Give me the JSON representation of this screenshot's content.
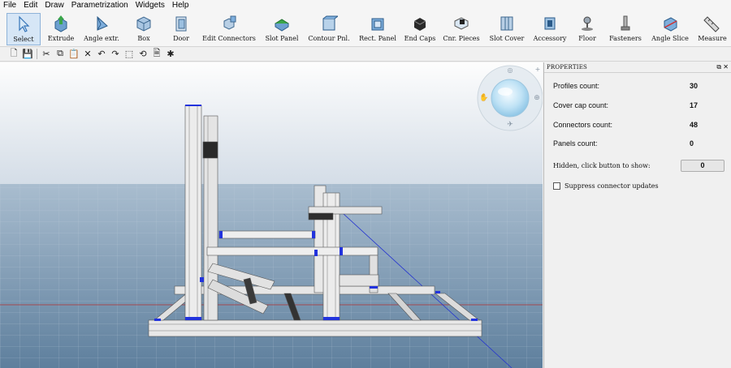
{
  "menu": [
    "File",
    "Edit",
    "Draw",
    "Parametrization",
    "Widgets",
    "Help"
  ],
  "ribbon": [
    {
      "label": "Select",
      "icon": "cursor-arrow-icon",
      "active": true
    },
    {
      "label": "Extrude",
      "icon": "extrude-profile-icon"
    },
    {
      "label": "Angle extr.",
      "icon": "angle-extrude-icon"
    },
    {
      "label": "Box",
      "icon": "box-icon"
    },
    {
      "label": "Door",
      "icon": "door-icon"
    },
    {
      "label": "Edit Connectors",
      "icon": "edit-connectors-icon"
    },
    {
      "label": "Slot Panel",
      "icon": "slot-panel-icon"
    },
    {
      "label": "Contour Pnl.",
      "icon": "contour-panel-icon"
    },
    {
      "label": "Rect. Panel",
      "icon": "rect-panel-icon"
    },
    {
      "label": "End Caps",
      "icon": "end-caps-icon"
    },
    {
      "label": "Cnr. Pieces",
      "icon": "corner-pieces-icon"
    },
    {
      "label": "Slot Cover",
      "icon": "slot-cover-icon"
    },
    {
      "label": "Accessory",
      "icon": "accessory-icon"
    },
    {
      "label": "Floor",
      "icon": "floor-icon"
    },
    {
      "label": "Fasteners",
      "icon": "fasteners-icon"
    },
    {
      "label": "Angle Slice",
      "icon": "angle-slice-icon"
    },
    {
      "label": "Measure",
      "icon": "measure-icon"
    }
  ],
  "toolbar": [
    "new-file-icon",
    "save-icon",
    "cut-icon",
    "copy-icon",
    "paste-icon",
    "delete-icon",
    "undo-icon",
    "redo-icon",
    "frame-select-icon",
    "rotate-icon",
    "document-icon",
    "bug-icon"
  ],
  "properties": {
    "title": "PROPERTIES",
    "rows": [
      {
        "label": "Profiles count:",
        "value": "30"
      },
      {
        "label": "Cover cap count:",
        "value": "17"
      },
      {
        "label": "Connectors count:",
        "value": "48"
      },
      {
        "label": "Panels count:",
        "value": "0"
      }
    ],
    "hidden_label": "Hidden, click button to show:",
    "hidden_value": "0",
    "suppress_label": "Suppress connector updates"
  },
  "colors": {
    "sky_top": "#fdfdfd",
    "sky_bottom": "#cfd9e3",
    "ground_top": "#a7bccf",
    "ground_bottom": "#5c7d9b",
    "profile": "#eeeeee",
    "connector": "#2233dd"
  }
}
